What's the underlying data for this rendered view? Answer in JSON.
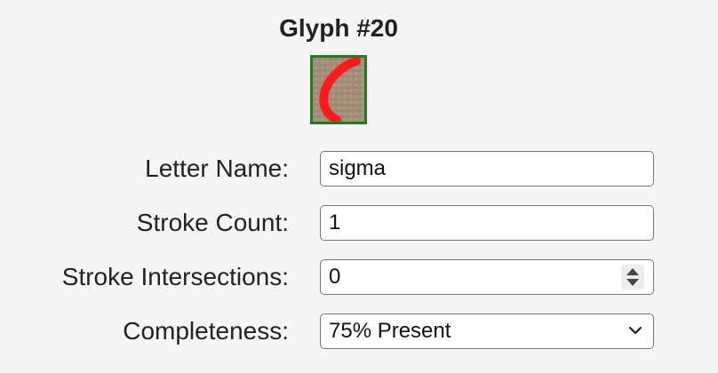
{
  "title": "Glyph #20",
  "thumbnail": {
    "icon": "glyph-stroke-thumbnail",
    "border_color": "#1e7d1e",
    "stroke_color": "#ff1a1a",
    "background_color": "#a08e78"
  },
  "form": {
    "letter_name": {
      "label": "Letter Name:",
      "value": "sigma"
    },
    "stroke_count": {
      "label": "Stroke Count:",
      "value": "1"
    },
    "stroke_intersections": {
      "label": "Stroke Intersections:",
      "value": "0"
    },
    "completeness": {
      "label": "Completeness:",
      "selected": "75% Present"
    }
  }
}
